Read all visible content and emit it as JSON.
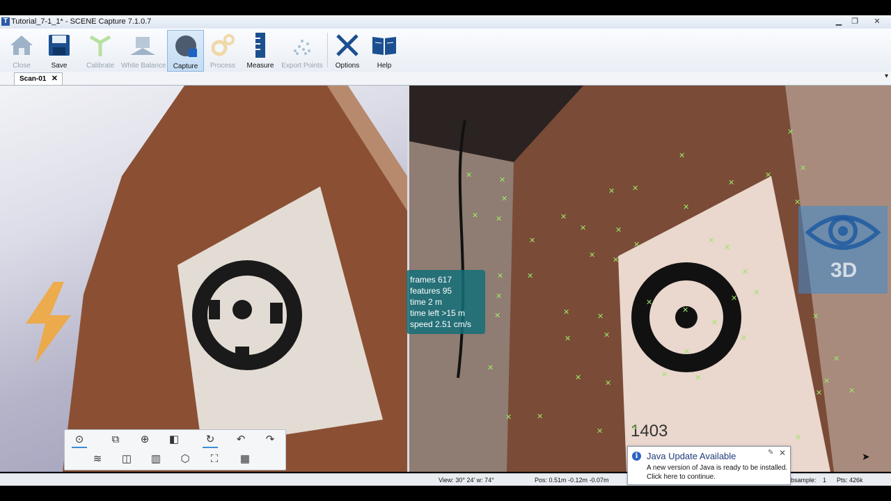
{
  "window": {
    "title": "Tutorial_7-1_1* - SCENE Capture 7.1.0.7",
    "app_icon": "T"
  },
  "ribbon": [
    {
      "label": "Close",
      "icon": "home-icon",
      "enabled": false
    },
    {
      "label": "Save",
      "icon": "floppy-disk-icon",
      "enabled": true
    },
    {
      "label": "Calibrate",
      "icon": "tripod-icon",
      "enabled": false
    },
    {
      "label": "White Balance",
      "icon": "white-balance-icon",
      "enabled": false
    },
    {
      "label": "Capture",
      "icon": "capture-icon",
      "enabled": true,
      "active": true
    },
    {
      "label": "Process",
      "icon": "gears-icon",
      "enabled": false
    },
    {
      "label": "Measure",
      "icon": "ruler-icon",
      "enabled": true
    },
    {
      "label": "Export Points",
      "icon": "point-cloud-icon",
      "enabled": false
    },
    {
      "label": "Options",
      "icon": "tools-icon",
      "enabled": true
    },
    {
      "label": "Help",
      "icon": "book-icon",
      "enabled": true
    }
  ],
  "tabs": [
    {
      "label": "Scan-01",
      "close": "✕"
    }
  ],
  "stats": {
    "frames": "frames 617",
    "features": "features 95",
    "time": "time 2 m",
    "time_left": "time left >15 m",
    "speed": "speed 2.51 cm/s"
  },
  "camera_label": "1403",
  "status": {
    "view": "View: 30° 24' w: 74°",
    "pos": "Pos: 0.51m -0.12m -0.07m",
    "subsample_label": "bsample:",
    "subsample_value": "1",
    "pts": "Pts: 426k"
  },
  "notification": {
    "title": "Java Update Available",
    "line1": "A new version of Java is ready to be installed.",
    "line2": "Click here to continue.",
    "pin": "✎",
    "close": "✕",
    "info": "i"
  },
  "overlay_3d_label": "3D",
  "colors": {
    "accent": "#3a8fd8",
    "stats_bg": "#146e78",
    "marker": "#9be86a",
    "wood": "#8a4f34"
  }
}
